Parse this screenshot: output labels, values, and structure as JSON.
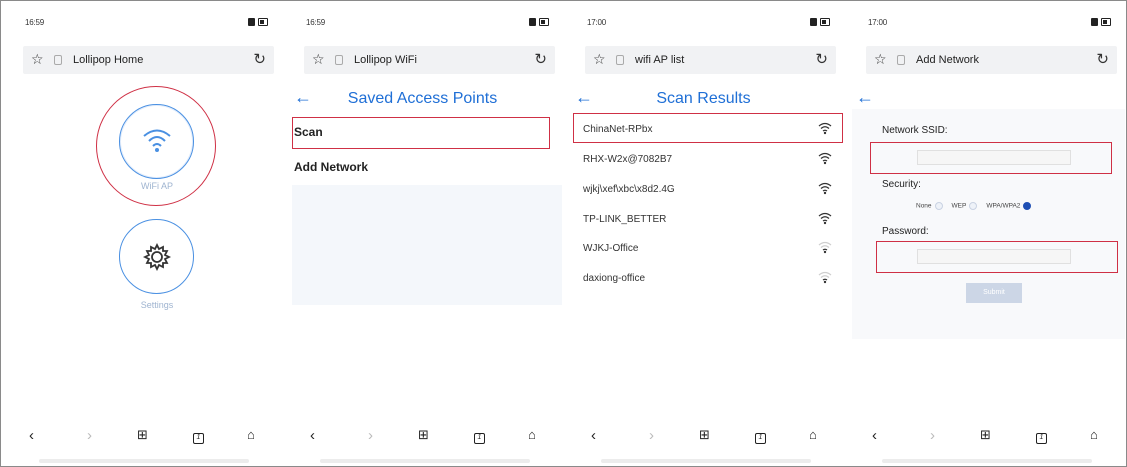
{
  "screens": [
    {
      "time": "16:59",
      "status_icons": "ail ail ᯤ HDs",
      "url_title": "Lollipop Home",
      "apps": [
        {
          "label": "WiFi AP",
          "icon": "wifi-icon"
        },
        {
          "label": "Settings",
          "icon": "gear-icon"
        }
      ]
    },
    {
      "time": "16:59",
      "status_icons": "ail ail ᯤ HDs",
      "url_title": "Lollipop WiFi",
      "header": "Saved Access Points",
      "menu": [
        "Scan",
        "Add Network"
      ]
    },
    {
      "time": "17:00",
      "status_icons": "ail ail ᯤ HDs",
      "url_title": "wifi AP list",
      "header": "Scan Results",
      "networks": [
        {
          "name": "ChinaNet-RPbx",
          "signal": 4
        },
        {
          "name": "RHX-W2x@7082B7",
          "signal": 3
        },
        {
          "name": "wjkj\\xef\\xbc\\x8d2.4G",
          "signal": 3
        },
        {
          "name": "TP-LINK_BETTER",
          "signal": 3
        },
        {
          "name": "WJKJ-Office",
          "signal": 1
        },
        {
          "name": "daxiong-office",
          "signal": 1
        }
      ]
    },
    {
      "time": "17:00",
      "status_icons": "ail ail ᯤ HDs",
      "url_title": "Add Network",
      "ssid_label": "Network SSID:",
      "security_label": "Security:",
      "security_options": [
        "None",
        "WEP",
        "WPA/WPA2"
      ],
      "security_selected": "WPA/WPA2",
      "password_label": "Password:",
      "submit_label": "Submit"
    }
  ],
  "nav_icons": [
    "back-icon",
    "forward-icon",
    "tabs-icon",
    "pages-icon",
    "home-icon"
  ],
  "colors": {
    "accent": "#1f6fd6",
    "highlight": "#cf3045",
    "ring": "#4a90e2"
  }
}
